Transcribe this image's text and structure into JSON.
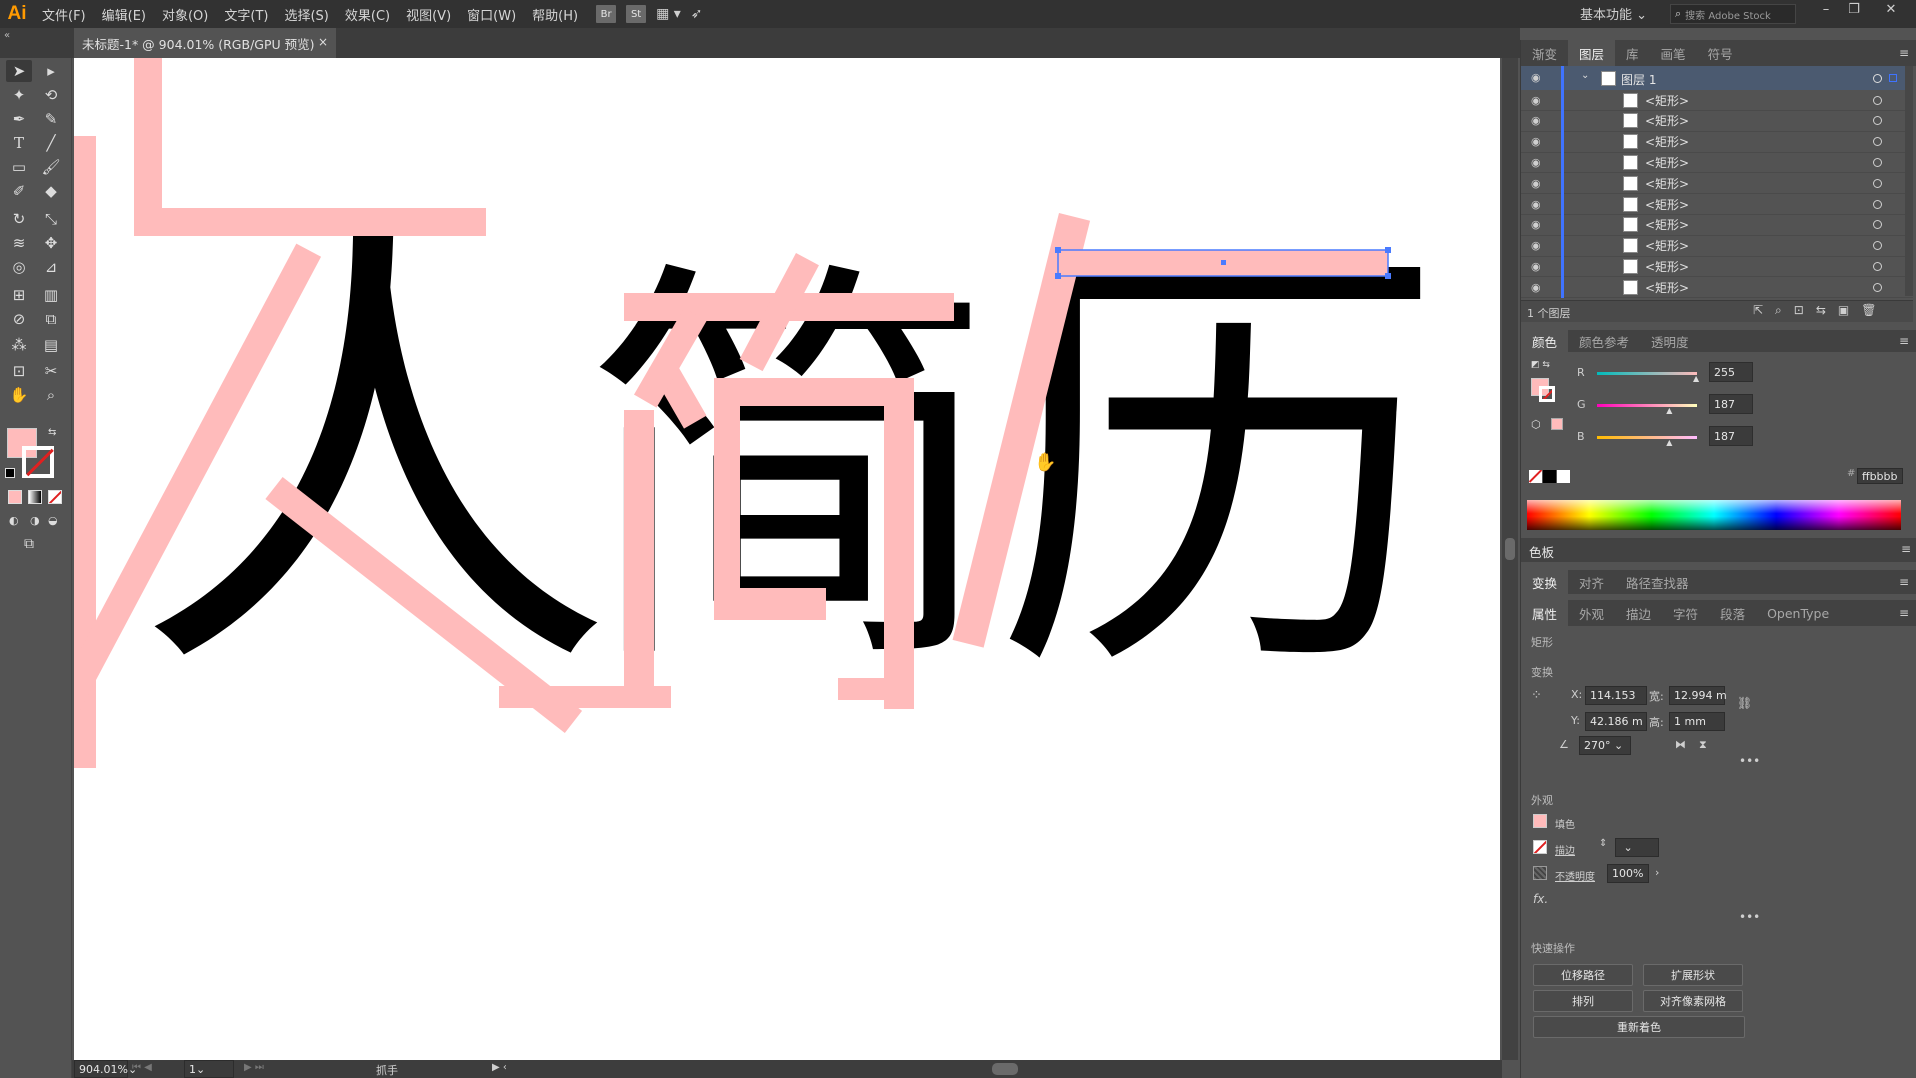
{
  "app": {
    "logo": "Ai",
    "workspace": "基本功能",
    "stock_placeholder": "搜索 Adobe Stock"
  },
  "menu": [
    "文件(F)",
    "编辑(E)",
    "对象(O)",
    "文字(T)",
    "选择(S)",
    "效果(C)",
    "视图(V)",
    "窗口(W)",
    "帮助(H)"
  ],
  "toolbar_apps": {
    "bridge": "Br",
    "stock": "St"
  },
  "document": {
    "tab_title": "未标题-1* @ 904.01% (RGB/GPU 预览)",
    "close": "×"
  },
  "canvas": {
    "chars": [
      "人",
      "简",
      "历"
    ],
    "fill_color": "#ffbbbb"
  },
  "status": {
    "zoom": "904.01%",
    "page": "1",
    "tool": "抓手"
  },
  "layers_panel": {
    "tabs": [
      "渐变",
      "图层",
      "库",
      "画笔",
      "符号"
    ],
    "active_tab": "图层",
    "top_layer": "图层 1",
    "items": [
      "<矩形>",
      "<矩形>",
      "<矩形>",
      "<矩形>",
      "<矩形>",
      "<矩形>",
      "<矩形>",
      "<矩形>",
      "<矩形>",
      "<矩形>"
    ],
    "footer": "1 个图层"
  },
  "color_panel": {
    "tabs": [
      "颜色",
      "颜色参考",
      "透明度"
    ],
    "r_label": "R",
    "g_label": "G",
    "b_label": "B",
    "r": "255",
    "g": "187",
    "b": "187",
    "r_level": 1.0,
    "g_level": 0.733,
    "b_level": 0.733,
    "hex": "ffbbbb",
    "swatch": "#ffbbbb"
  },
  "swatches_panel": {
    "title": "色板"
  },
  "transform_tabs": [
    "变换",
    "对齐",
    "路径查找器"
  ],
  "properties": {
    "tabs": [
      "属性",
      "外观",
      "描边",
      "字符",
      "段落",
      "OpenType"
    ],
    "object_type": "矩形",
    "transform_label": "变换",
    "x_label": "X:",
    "x": "114.153",
    "y_label": "Y:",
    "y": "42.186 m",
    "w_label": "宽:",
    "w": "12.994 m",
    "h_label": "高:",
    "h": "1 mm",
    "angle": "270°",
    "appearance_label": "外观",
    "fill_label": "填色",
    "stroke_label": "描边",
    "opacity_label": "不透明度",
    "opacity": "100%",
    "fx": "fx.",
    "quick_actions_label": "快速操作",
    "quick_actions": [
      "位移路径",
      "扩展形状",
      "排列",
      "对齐像素网格",
      "重新着色"
    ]
  }
}
